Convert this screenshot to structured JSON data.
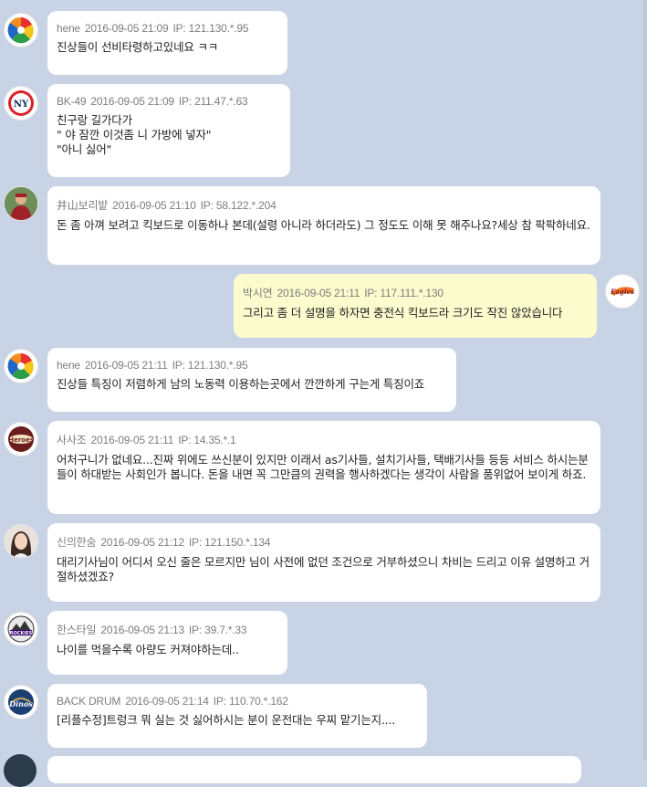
{
  "messages": [
    {
      "author": "hene",
      "date": "2016-09-05 21:09",
      "ip": "IP: 121.130.*.95",
      "text": "진상들이 선비타령하고있네요 ㅋㅋ",
      "avatar_icon": "pinwheel-logo-icon"
    },
    {
      "author": "BK-49",
      "date": "2016-09-05 21:09",
      "ip": "IP: 211.47.*.63",
      "text": "친구랑 길가다가\n\" 야 잠깐 이것좀 니 가방에 넣자\"\n\"아니 싫어\"",
      "avatar_icon": "yankees-logo-icon"
    },
    {
      "author": "井山보리밭",
      "date": "2016-09-05 21:10",
      "ip": "IP: 58.122.*.204",
      "text": "돈 좀 아껴 보려고 킥보드로 이동하나 본데(설령 아니라 하더라도) 그 정도도 이해 못 해주나요?세상 참 팍팍하네요.",
      "avatar_icon": "player-photo-icon"
    },
    {
      "author": "박시연",
      "date": "2016-09-05 21:11",
      "ip": "IP: 117.111.*.130",
      "text": "그리고 좀 더 설명을 하자면 충전식 킥보드라 크기도 작진 않았습니다",
      "avatar_icon": "eagles-logo-icon"
    },
    {
      "author": "hene",
      "date": "2016-09-05 21:11",
      "ip": "IP: 121.130.*.95",
      "text": "진상들 특징이 저렴하게 남의 노동력 이용하는곳에서 깐깐하게 구는게 특징이죠",
      "avatar_icon": "pinwheel-logo-icon"
    },
    {
      "author": "사사조",
      "date": "2016-09-05 21:11",
      "ip": "IP: 14.35.*.1",
      "text": "어처구니가 없네요...진짜 위에도 쓰신분이 있지만 이래서 as기사들, 설치기사들, 택배기사들 등등 서비스 하시는분들이 하대받는 사회인가 봅니다. 돈을 내면 꼭 그만큼의 권력을 행사하겠다는 생각이 사람을 품위없어 보이게 하죠.",
      "avatar_icon": "heroes-logo-icon"
    },
    {
      "author": "신의한숨",
      "date": "2016-09-05 21:12",
      "ip": "IP: 121.150.*.134",
      "text": "대리기사님이 어디서 오신 줄은 모르지만 님이 사전에 없던 조건으로 거부하셨으니 차비는 드리고 이유 설명하고 거절하셨겠죠?",
      "avatar_icon": "woman-photo-icon"
    },
    {
      "author": "한스타일",
      "date": "2016-09-05 21:13",
      "ip": "IP: 39.7.*.33",
      "text": "나이를 먹을수록 아량도 커져야하는데..",
      "avatar_icon": "rockies-logo-icon"
    },
    {
      "author": "BACK DRUM",
      "date": "2016-09-05 21:14",
      "ip": "IP: 110.70.*.162",
      "text": "[리플수정]트렁크 뭐 실는 것 싫어하시는 분이 운전대는 우찌 맡기는지....",
      "avatar_icon": "dinos-logo-icon"
    }
  ],
  "logo_text": {
    "yankees": "NY",
    "eagles": "Eagles",
    "heroes": "Heroes",
    "rockies": "ROCKIES",
    "dinos": "Dinos"
  }
}
